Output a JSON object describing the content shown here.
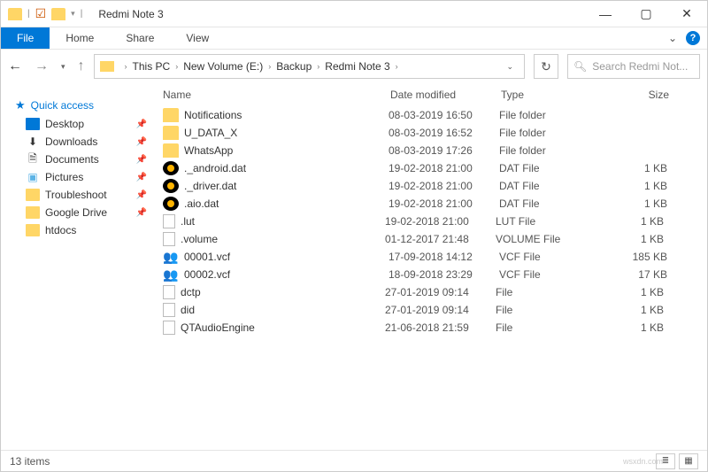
{
  "window": {
    "title": "Redmi Note 3"
  },
  "ribbon": {
    "file": "File",
    "tabs": [
      "Home",
      "Share",
      "View"
    ]
  },
  "breadcrumb": [
    "This PC",
    "New Volume (E:)",
    "Backup",
    "Redmi Note 3"
  ],
  "search": {
    "placeholder": "Search Redmi Not..."
  },
  "sidebar": {
    "quick_access": "Quick access",
    "items": [
      {
        "label": "Desktop",
        "icon": "desktop",
        "pinned": true
      },
      {
        "label": "Downloads",
        "icon": "downloads",
        "pinned": true
      },
      {
        "label": "Documents",
        "icon": "documents",
        "pinned": true
      },
      {
        "label": "Pictures",
        "icon": "pictures",
        "pinned": true
      },
      {
        "label": "Troubleshoot",
        "icon": "folder",
        "pinned": true
      },
      {
        "label": "Google Drive",
        "icon": "folder",
        "pinned": true
      },
      {
        "label": "htdocs",
        "icon": "folder",
        "pinned": false
      }
    ]
  },
  "columns": {
    "name": "Name",
    "date": "Date modified",
    "type": "Type",
    "size": "Size"
  },
  "files": [
    {
      "name": "Notifications",
      "date": "08-03-2019 16:50",
      "type": "File folder",
      "size": "",
      "icon": "folder"
    },
    {
      "name": "U_DATA_X",
      "date": "08-03-2019 16:52",
      "type": "File folder",
      "size": "",
      "icon": "folder"
    },
    {
      "name": "WhatsApp",
      "date": "08-03-2019 17:26",
      "type": "File folder",
      "size": "",
      "icon": "folder"
    },
    {
      "name": "._android.dat",
      "date": "19-02-2018 21:00",
      "type": "DAT File",
      "size": "1 KB",
      "icon": "dat"
    },
    {
      "name": "._driver.dat",
      "date": "19-02-2018 21:00",
      "type": "DAT File",
      "size": "1 KB",
      "icon": "dat"
    },
    {
      "name": ".aio.dat",
      "date": "19-02-2018 21:00",
      "type": "DAT File",
      "size": "1 KB",
      "icon": "dat"
    },
    {
      "name": ".lut",
      "date": "19-02-2018 21:00",
      "type": "LUT File",
      "size": "1 KB",
      "icon": "file"
    },
    {
      "name": ".volume",
      "date": "01-12-2017 21:48",
      "type": "VOLUME File",
      "size": "1 KB",
      "icon": "file"
    },
    {
      "name": "00001.vcf",
      "date": "17-09-2018 14:12",
      "type": "VCF File",
      "size": "185 KB",
      "icon": "vcf"
    },
    {
      "name": "00002.vcf",
      "date": "18-09-2018 23:29",
      "type": "VCF File",
      "size": "17 KB",
      "icon": "vcf"
    },
    {
      "name": "dctp",
      "date": "27-01-2019 09:14",
      "type": "File",
      "size": "1 KB",
      "icon": "file"
    },
    {
      "name": "did",
      "date": "27-01-2019 09:14",
      "type": "File",
      "size": "1 KB",
      "icon": "file"
    },
    {
      "name": "QTAudioEngine",
      "date": "21-06-2018 21:59",
      "type": "File",
      "size": "1 KB",
      "icon": "file"
    }
  ],
  "status": {
    "text": "13 items"
  },
  "watermark": "wsxdn.com"
}
